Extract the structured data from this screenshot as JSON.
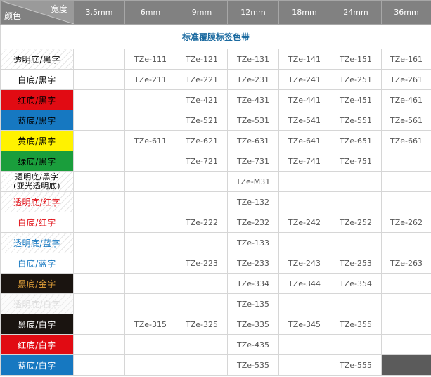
{
  "header": {
    "width_label": "宽度",
    "color_label": "颜色",
    "sizes": [
      "3.5mm",
      "6mm",
      "9mm",
      "12mm",
      "18mm",
      "24mm",
      "36mm"
    ]
  },
  "title": "标准覆膜标签色带",
  "rows": [
    {
      "label": "透明底/黑字",
      "bg": "hatch",
      "fg": "#000000",
      "cells": [
        "",
        "TZe-111",
        "TZe-121",
        "TZe-131",
        "TZe-141",
        "TZe-151",
        "TZe-161"
      ]
    },
    {
      "label": "白底/黑字",
      "bg": "#ffffff",
      "fg": "#000000",
      "cells": [
        "",
        "TZe-211",
        "TZe-221",
        "TZe-231",
        "TZe-241",
        "TZe-251",
        "TZe-261"
      ]
    },
    {
      "label": "红底/黑字",
      "bg": "#e10b13",
      "fg": "#000000",
      "cells": [
        "",
        "",
        "TZe-421",
        "TZe-431",
        "TZe-441",
        "TZe-451",
        "TZe-461"
      ]
    },
    {
      "label": "蓝底/黑字",
      "bg": "#1678c1",
      "fg": "#000000",
      "cells": [
        "",
        "",
        "TZe-521",
        "TZe-531",
        "TZe-541",
        "TZe-551",
        "TZe-561"
      ]
    },
    {
      "label": "黄底/黑字",
      "bg": "#fff200",
      "fg": "#000000",
      "cells": [
        "",
        "TZe-611",
        "TZe-621",
        "TZe-631",
        "TZe-641",
        "TZe-651",
        "TZe-661"
      ]
    },
    {
      "label": "绿底/黑字",
      "bg": "#1a9e3c",
      "fg": "#000000",
      "cells": [
        "",
        "",
        "TZe-721",
        "TZe-731",
        "TZe-741",
        "TZe-751",
        ""
      ]
    },
    {
      "label": "透明底/黑字\n(亚光透明底)",
      "bg": "hatch",
      "fg": "#000000",
      "two": true,
      "cells": [
        "",
        "",
        "",
        "TZe-M31",
        "",
        "",
        ""
      ]
    },
    {
      "label": "透明底/红字",
      "bg": "hatch",
      "fg": "#e10b13",
      "cells": [
        "",
        "",
        "",
        "TZe-132",
        "",
        "",
        ""
      ]
    },
    {
      "label": "白底/红字",
      "bg": "#ffffff",
      "fg": "#e10b13",
      "cells": [
        "",
        "",
        "TZe-222",
        "TZe-232",
        "TZe-242",
        "TZe-252",
        "TZe-262"
      ]
    },
    {
      "label": "透明底/蓝字",
      "bg": "hatch",
      "fg": "#1678c1",
      "cells": [
        "",
        "",
        "",
        "TZe-133",
        "",
        "",
        ""
      ]
    },
    {
      "label": "白底/蓝字",
      "bg": "#ffffff",
      "fg": "#1678c1",
      "cells": [
        "",
        "",
        "TZe-223",
        "TZe-233",
        "TZe-243",
        "TZe-253",
        "TZe-263"
      ]
    },
    {
      "label": "黑底/金字",
      "bg": "#1a1410",
      "fg": "#e6a33a",
      "cells": [
        "",
        "",
        "",
        "TZe-334",
        "TZe-344",
        "TZe-354",
        ""
      ]
    },
    {
      "label": "透明底/白字",
      "bg": "hatch-soft",
      "fg": "#dcdcdc",
      "cells": [
        "",
        "",
        "",
        "TZe-135",
        "",
        "",
        ""
      ]
    },
    {
      "label": "黑底/白字",
      "bg": "#1a1410",
      "fg": "#ffffff",
      "cells": [
        "",
        "TZe-315",
        "TZe-325",
        "TZe-335",
        "TZe-345",
        "TZe-355",
        ""
      ]
    },
    {
      "label": "红底/白字",
      "bg": "#e10b13",
      "fg": "#ffffff",
      "cells": [
        "",
        "",
        "",
        "TZe-435",
        "",
        "",
        ""
      ]
    },
    {
      "label": "蓝底/白字",
      "bg": "#1678c1",
      "fg": "#ffffff",
      "cells": [
        "",
        "",
        "",
        "TZe-535",
        "",
        "TZe-555",
        "dark"
      ]
    }
  ]
}
